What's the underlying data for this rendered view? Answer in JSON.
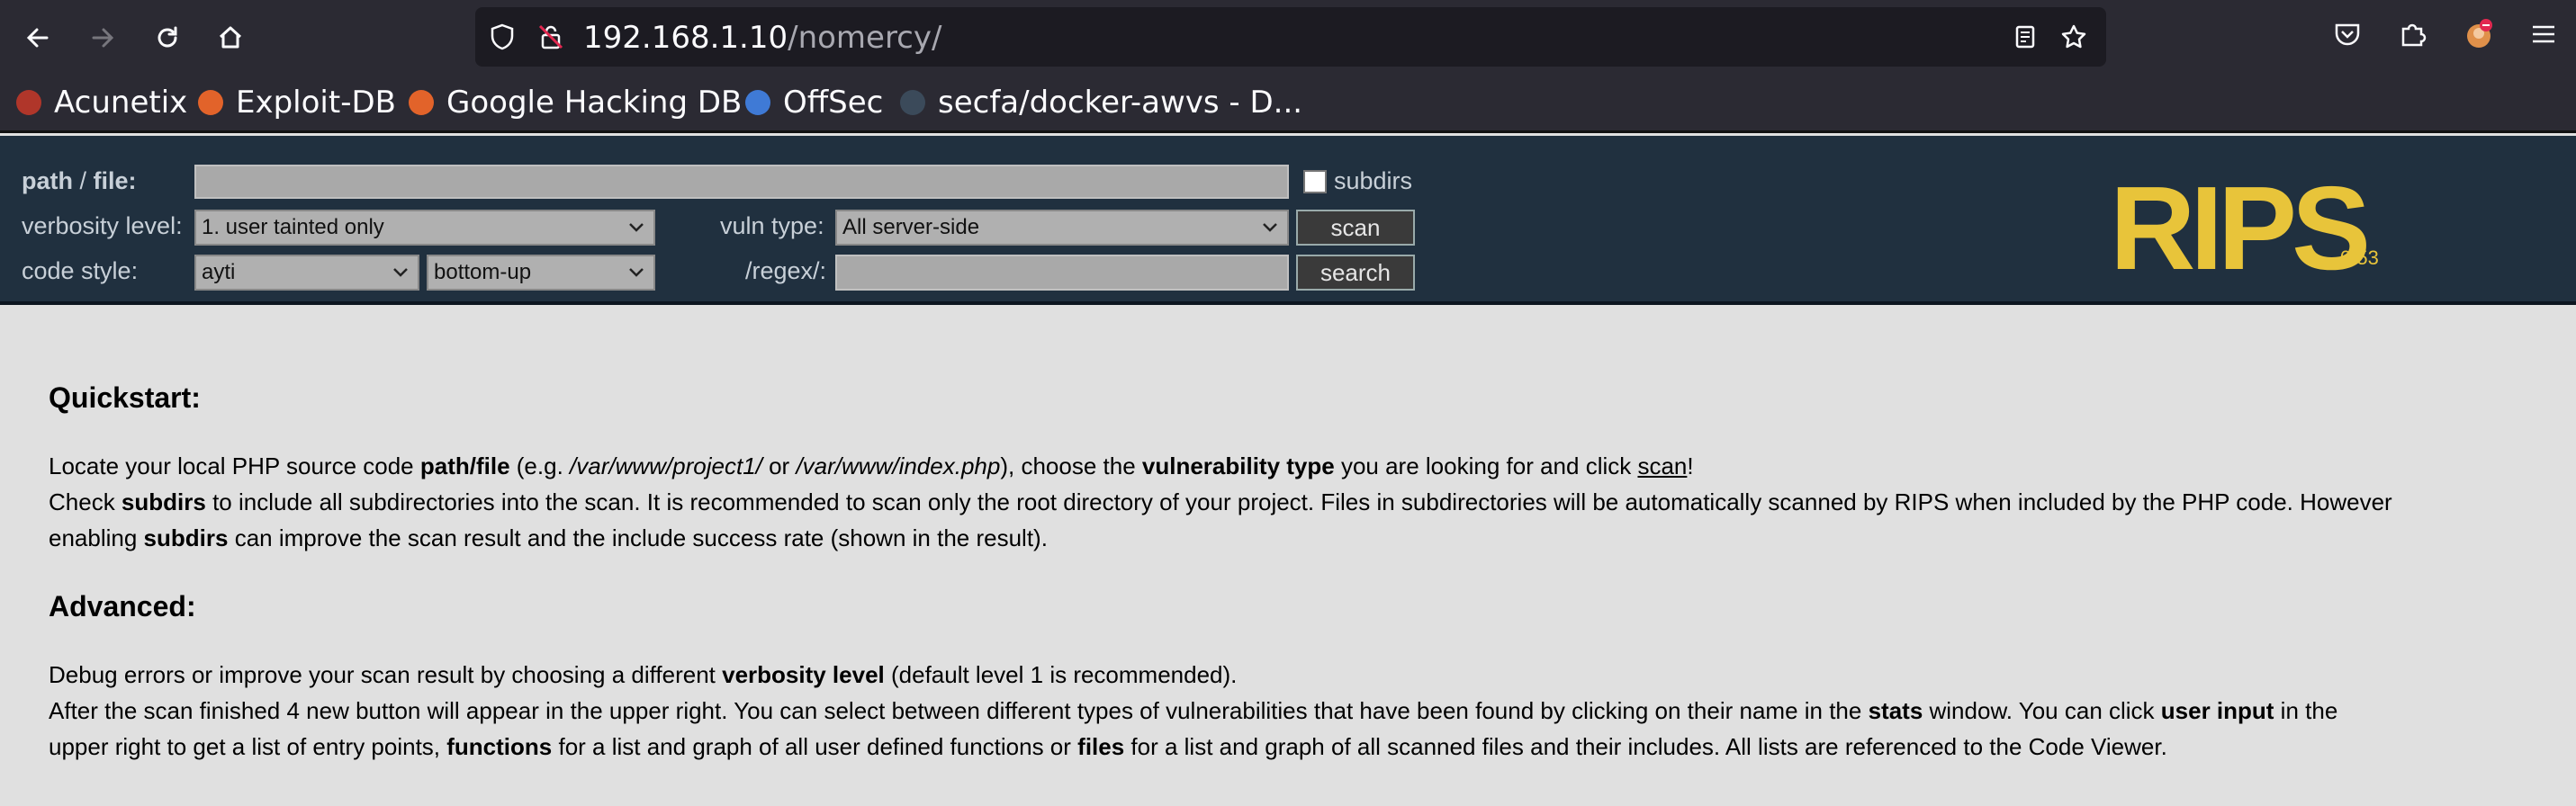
{
  "browser": {
    "url_host": "192.168.1.10",
    "url_path": "/nomercy/",
    "bookmarks": [
      {
        "label": "Acunetix",
        "color": "#b0362a"
      },
      {
        "label": "Exploit-DB",
        "color": "#e2632a"
      },
      {
        "label": "Google Hacking DB",
        "color": "#e2632a"
      },
      {
        "label": "OffSec",
        "color": "#3f7ad6"
      },
      {
        "label": "secfa/docker-awvs - D...",
        "color": "#3b4a5a"
      }
    ]
  },
  "rips": {
    "path_label": "path",
    "path_sep": " / ",
    "file_label": "file:",
    "subdirs_label": "subdirs",
    "verbosity_label": "verbosity level:",
    "verbosity_value": "1. user tainted only",
    "vuln_type_label": "vuln type:",
    "vuln_type_value": "All server-side",
    "scan_label": "scan",
    "code_style_label": "code style:",
    "code_style_value": "ayti",
    "order_value": "bottom-up",
    "regex_label": "/regex/:",
    "search_label": "search",
    "logo_text": "RIPS",
    "version": "0.53",
    "logo_color": "#e8c43a"
  },
  "content": {
    "quickstart_heading": "Quickstart:",
    "q1": {
      "t1": "Locate your local PHP source code ",
      "b1": "path/file",
      "t2": " (e.g. ",
      "i1": "/var/www/project1/",
      "t3": " or ",
      "i2": "/var/www/index.php",
      "t4": "), choose the ",
      "b2": "vulnerability type",
      "t5": " you are looking for and click ",
      "u1": "scan",
      "t6": "!"
    },
    "q2": {
      "t1": "Check ",
      "b1": "subdirs",
      "t2": " to include all subdirectories into the scan. It is recommended to scan only the root directory of your project. Files in subdirectories will be automatically scanned by RIPS when included by the PHP code. However"
    },
    "q3": {
      "t1": "enabling ",
      "b1": "subdirs",
      "t2": " can improve the scan result and the include success rate (shown in the result)."
    },
    "advanced_heading": "Advanced:",
    "a1": {
      "t1": "Debug errors or improve your scan result by choosing a different ",
      "b1": "verbosity level",
      "t2": " (default level 1 is recommended)."
    },
    "a2": {
      "t1": "After the scan finished 4 new button will appear in the upper right. You can select between different types of vulnerabilities that have been found by clicking on their name in the ",
      "b1": "stats",
      "t2": " window. You can click ",
      "b2": "user input",
      "t3": " in the"
    },
    "a3": {
      "t1": "upper right to get a list of entry points, ",
      "b1": "functions",
      "t2": " for a list and graph of all user defined functions or ",
      "b2": "files",
      "t3": " for a list and graph of all scanned files and their includes. All lists are referenced to the Code Viewer."
    }
  }
}
